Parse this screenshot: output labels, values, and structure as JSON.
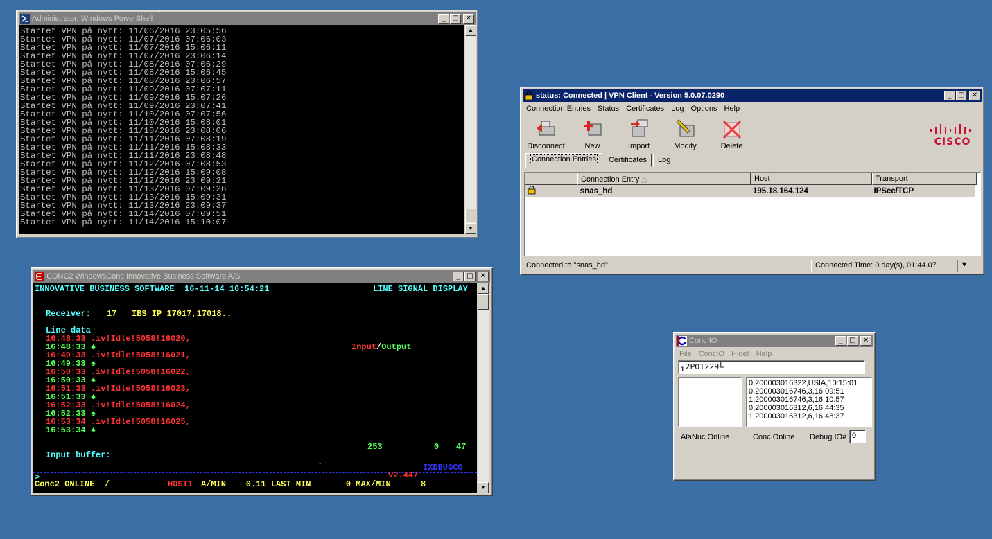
{
  "powershell": {
    "title": "Administrator: Windows PowerShell",
    "lines": [
      "Startet VPN på nytt: 11/06/2016 23:05:56",
      "Startet VPN på nytt: 11/07/2016 07:06:03",
      "Startet VPN på nytt: 11/07/2016 15:06:11",
      "Startet VPN på nytt: 11/07/2016 23:06:14",
      "Startet VPN på nytt: 11/08/2016 07:06:29",
      "Startet VPN på nytt: 11/08/2016 15:06:45",
      "Startet VPN på nytt: 11/08/2016 23:06:57",
      "Startet VPN på nytt: 11/09/2016 07:07:11",
      "Startet VPN på nytt: 11/09/2016 15:07:26",
      "Startet VPN på nytt: 11/09/2016 23:07:41",
      "Startet VPN på nytt: 11/10/2016 07:07:56",
      "Startet VPN på nytt: 11/10/2016 15:08:01",
      "Startet VPN på nytt: 11/10/2016 23:08:06",
      "Startet VPN på nytt: 11/11/2016 07:08:19",
      "Startet VPN på nytt: 11/11/2016 15:08:33",
      "Startet VPN på nytt: 11/11/2016 23:08:48",
      "Startet VPN på nytt: 11/12/2016 07:08:53",
      "Startet VPN på nytt: 11/12/2016 15:09:08",
      "Startet VPN på nytt: 11/12/2016 23:09:21",
      "Startet VPN på nytt: 11/13/2016 07:09:26",
      "Startet VPN på nytt: 11/13/2016 15:09:31",
      "Startet VPN på nytt: 11/13/2016 23:09:37",
      "Startet VPN på nytt: 11/14/2016 07:09:51",
      "Startet VPN på nytt: 11/14/2016 15:10:07"
    ]
  },
  "vpn": {
    "title": "status: Connected | VPN Client - Version 5.0.07.0290",
    "menu": [
      "Connection Entries",
      "Status",
      "Certificates",
      "Log",
      "Options",
      "Help"
    ],
    "toolbar": [
      {
        "label": "Disconnect",
        "icon": "disconnect-icon"
      },
      {
        "label": "New",
        "icon": "new-icon"
      },
      {
        "label": "Import",
        "icon": "import-icon"
      },
      {
        "label": "Modify",
        "icon": "modify-icon"
      },
      {
        "label": "Delete",
        "icon": "delete-icon"
      }
    ],
    "logo": "cisco",
    "tabs": [
      "Connection Entries",
      "Certificates",
      "Log"
    ],
    "columns": [
      "Connection Entry",
      "Host",
      "Transport"
    ],
    "rows": [
      {
        "entry": "snas_hd",
        "host": "195.18.164.124",
        "transport": "IPSec/TCP"
      }
    ],
    "status_left": "Connected to \"snas_hd\".",
    "status_right": "Connected Time: 0 day(s), 01:44.07"
  },
  "conc2": {
    "title": "CONC2   WindowsConc   Innovative Business Software A/S",
    "header_left": "INNOVATIVE BUSINESS SOFTWARE  16-11-14 16:54:21",
    "header_right": "LINE SIGNAL DISPLAY",
    "receiver_label": "Receiver:",
    "receiver_value": "17   IBS IP 17017,17018..",
    "line_data_label": "Line data",
    "io_input": "Input",
    "io_sep": "/",
    "io_output": "Output",
    "entries": [
      {
        "time": "16:48:33",
        "text": ".iv!Idle!5058!16020,"
      },
      {
        "time": "16:48:33",
        "text": "♠"
      },
      {
        "time": "16:49:33",
        "text": ".iv!Idle!5058!16021,"
      },
      {
        "time": "16:49:33",
        "text": "♠"
      },
      {
        "time": "16:50:33",
        "text": ".iv!Idle!5058!16022,"
      },
      {
        "time": "16:50:33",
        "text": "♠"
      },
      {
        "time": "16:51:33",
        "text": ".iv!Idle!5058!16023,"
      },
      {
        "time": "16:51:33",
        "text": "♠"
      },
      {
        "time": "16:52:33",
        "text": ".iv!Idle!5058!16024,"
      },
      {
        "time": "16:52:33",
        "text": "♠"
      },
      {
        "time": "16:53:34",
        "text": ".iv!Idle!5058!16025,"
      },
      {
        "time": "16:53:34",
        "text": "♠"
      }
    ],
    "counter_1": "253",
    "counter_2": "0",
    "counter_3": "47",
    "input_buffer_label": "Input buffer:",
    "dot": ".",
    "ixdbugco": "IXDBUGCO",
    "prompt": ">",
    "version": "v2.447",
    "status_online": "Conc2 ONLINE  /",
    "status_host": "HOST1",
    "status_amin": "A/MIN    0.11 LAST MIN       0 MAX/MIN      8"
  },
  "concio": {
    "title": "Conc IO",
    "menu": [
      "File",
      "ConcIO",
      "Hide!",
      "Help"
    ],
    "input_value": "╗2P01229╚",
    "list": [
      "0,200003016322,USIA,10:15:01",
      "0,200003016746,3,16:09:51",
      "1,200003016746,3,16:10:57",
      "0,200003016312,6,16:44:35",
      "1,200003016312,6,16:48:37"
    ],
    "alanuc": "AlaNuc Online",
    "conc_online": "Conc Online",
    "debug_label": "Debug IO#",
    "debug_value": "0"
  },
  "colors": {
    "desktop": "#3a6ea5",
    "titlebar_active": "#0a246a",
    "titlebar_inactive": "#808080",
    "cisco": "#c8102e"
  }
}
